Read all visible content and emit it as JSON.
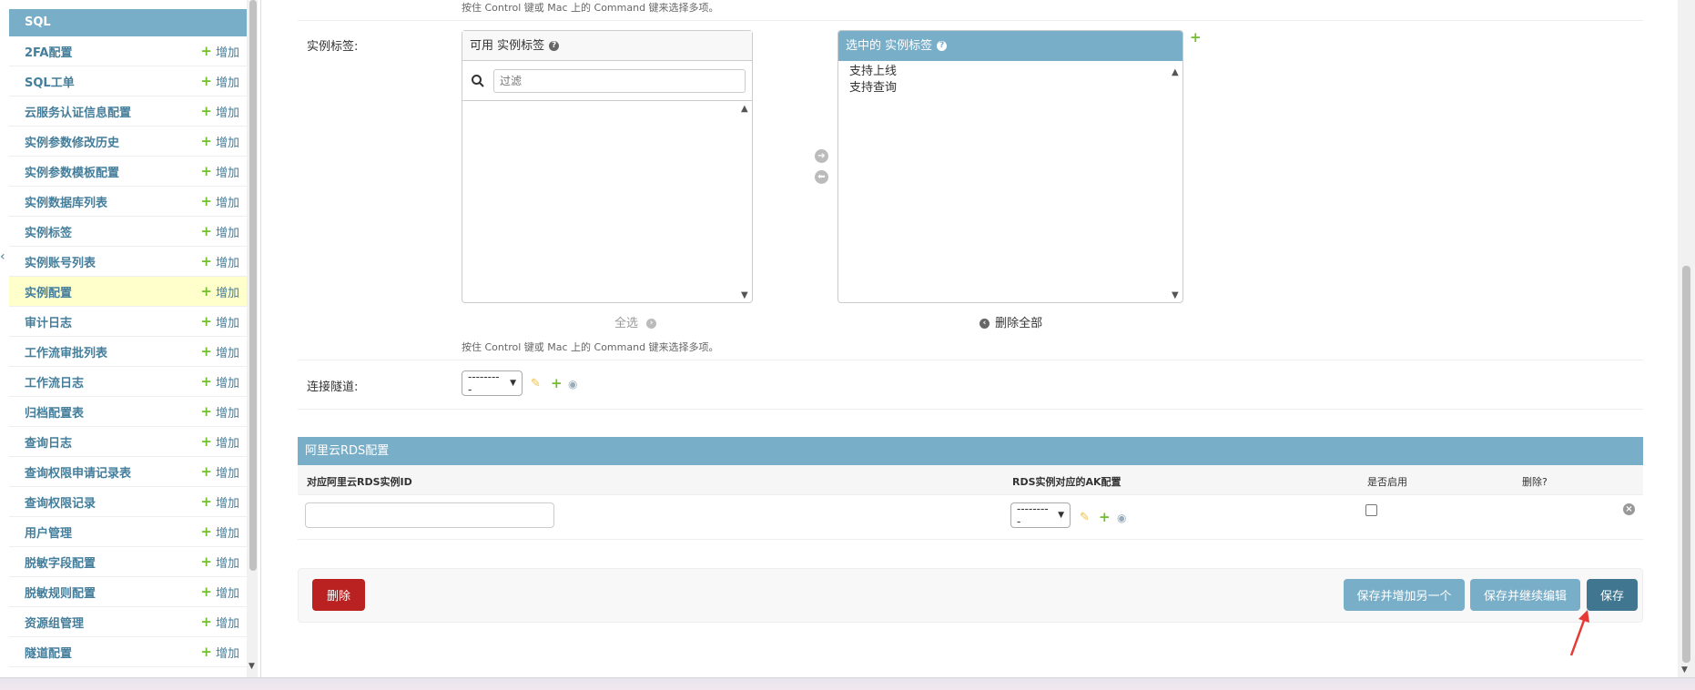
{
  "sidebar": {
    "module_title": "SQL",
    "add_label": "增加",
    "items": [
      {
        "name": "2FA配置"
      },
      {
        "name": "SQL工单"
      },
      {
        "name": "云服务认证信息配置"
      },
      {
        "name": "实例参数修改历史"
      },
      {
        "name": "实例参数模板配置"
      },
      {
        "name": "实例数据库列表"
      },
      {
        "name": "实例标签"
      },
      {
        "name": "实例账号列表"
      },
      {
        "name": "实例配置"
      },
      {
        "name": "审计日志"
      },
      {
        "name": "工作流审批列表"
      },
      {
        "name": "工作流日志"
      },
      {
        "name": "归档配置表"
      },
      {
        "name": "查询日志"
      },
      {
        "name": "查询权限申请记录表"
      },
      {
        "name": "查询权限记录"
      },
      {
        "name": "用户管理"
      },
      {
        "name": "脱敏字段配置"
      },
      {
        "name": "脱敏规则配置"
      },
      {
        "name": "资源组管理"
      },
      {
        "name": "隧道配置"
      }
    ],
    "current_item": "实例配置"
  },
  "form": {
    "top_hint": "按住 Control 键或 Mac 上的 Command 键来选择多项。",
    "tags": {
      "label": "实例标签:",
      "available_title": "可用 实例标签",
      "filter_placeholder": "过滤",
      "chosen_title": "选中的 实例标签",
      "chosen_options": [
        "支持上线",
        "支持查询"
      ],
      "choose_all": "全选",
      "remove_all": "删除全部",
      "hint": "按住 Control 键或 Mac 上的 Command 键来选择多项。"
    },
    "tunnel": {
      "label": "连接隧道:",
      "selected": "---------"
    }
  },
  "inline": {
    "title": "阿里云RDS配置",
    "columns": {
      "rds_id": "对应阿里云RDS实例ID",
      "ak_config": "RDS实例对应的AK配置",
      "enabled": "是否启用",
      "delete": "删除?"
    },
    "row": {
      "ak_selected": "---------"
    }
  },
  "submit": {
    "delete": "删除",
    "save_add_another": "保存并增加另一个",
    "save_continue": "保存并继续编辑",
    "save": "保存"
  },
  "colors": {
    "primary": "#79aec8",
    "dark_primary": "#417690",
    "link": "#447e9b",
    "delete": "#ba2121",
    "add_plus": "#70bf2b",
    "current_row": "#ffffcc",
    "annotation_arrow": "#e53935"
  }
}
